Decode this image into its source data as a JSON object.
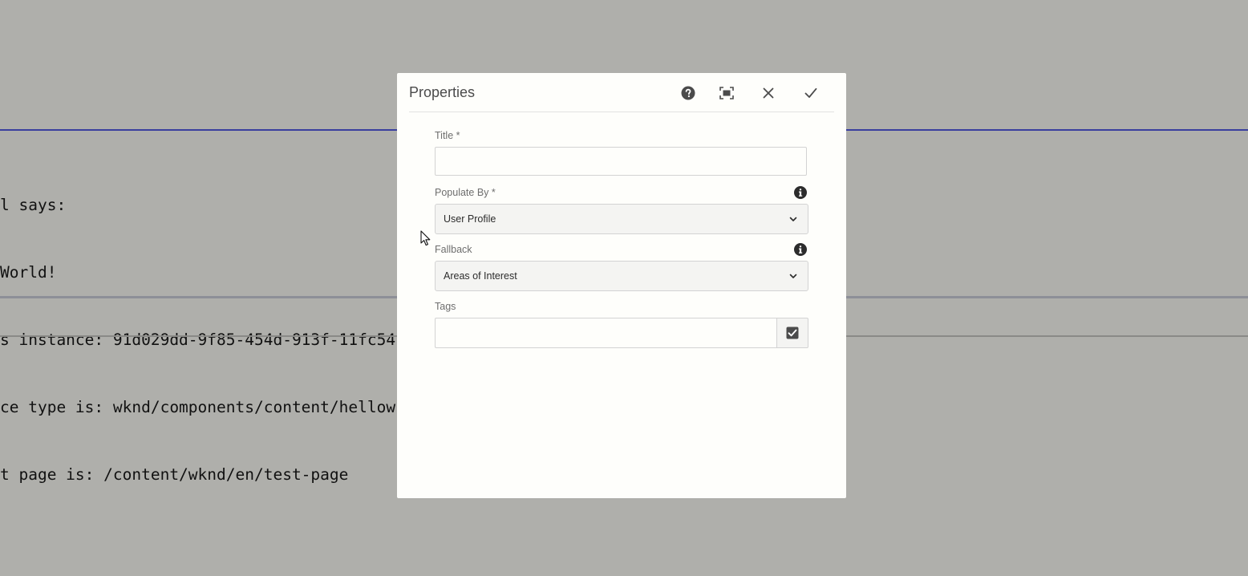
{
  "background_code": {
    "lines": [
      "l says:",
      "World!",
      "s instance: 91d029dd-9f85-454d-913f-11fc54",
      "ce type is: wknd/components/content/hellow",
      "t page is: /content/wknd/en/test-page"
    ]
  },
  "dialog": {
    "title": "Properties",
    "header_buttons": [
      {
        "name": "help",
        "icon": "help-icon"
      },
      {
        "name": "fullscreen",
        "icon": "fullscreen-icon"
      },
      {
        "name": "cancel",
        "icon": "close-icon"
      },
      {
        "name": "done",
        "icon": "checkmark-icon"
      }
    ],
    "fields": {
      "title": {
        "label": "Title *",
        "value": "",
        "placeholder": ""
      },
      "populate_by": {
        "label": "Populate By *",
        "selected": "User Profile",
        "info_icon": "info-icon"
      },
      "fallback": {
        "label": "Fallback",
        "selected": "Areas of Interest",
        "info_icon": "info-icon"
      },
      "tags": {
        "label": "Tags",
        "value": "",
        "button_icon": "checkbox-check-icon"
      }
    }
  },
  "colors": {
    "page_background": "#afafab",
    "dialog_background": "#fefefb",
    "accent_line": "#3a3f9e",
    "icon": "#4b4b4b"
  }
}
